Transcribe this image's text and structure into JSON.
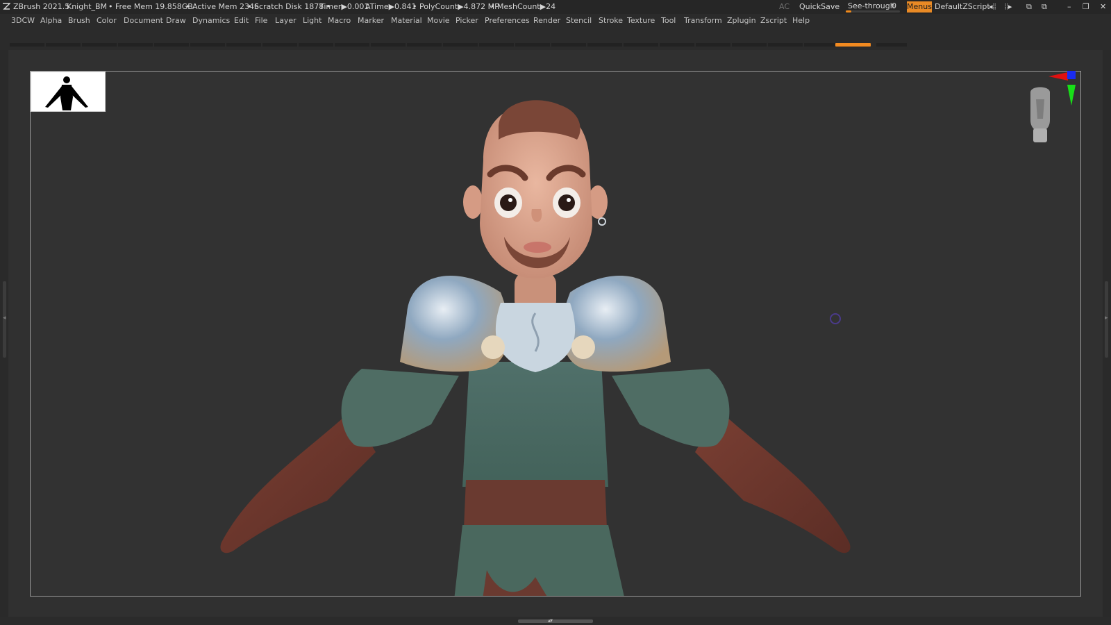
{
  "app": {
    "name": "ZBrush 2021.5",
    "document_name": "Knight_BM"
  },
  "status": {
    "free_mem": "• Free Mem 19.858GB",
    "active_mem": "• Active Mem 2346",
    "scratch_disk": "• Scratch Disk 1878 •",
    "timer": "Timer▶0.001",
    "atime": "ATime▶0.841",
    "polycount": "• PolyCount▶4.872 MP",
    "meshcount": "• MeshCount▶24"
  },
  "toolbar": {
    "ac_label": "AC",
    "quicksave_label": "QuickSave",
    "seethrough_label": "See-through",
    "seethrough_value": "0",
    "seethrough_fraction": 0.0,
    "menus_label": "Menus",
    "script_label": "DefaultZScript"
  },
  "menu": {
    "items": [
      "3DCW",
      "Alpha",
      "Brush",
      "Color",
      "Document",
      "Draw",
      "Dynamics",
      "Edit",
      "File",
      "Layer",
      "Light",
      "Macro",
      "Marker",
      "Material",
      "Movie",
      "Picker",
      "Preferences",
      "Render",
      "Stencil",
      "Stroke",
      "Texture",
      "Tool",
      "Transform",
      "Zplugin",
      "Zscript",
      "Help"
    ]
  },
  "colors": {
    "accent": "#e98a25",
    "background": "#303030",
    "skin": "#d7a38e",
    "tunic": "#4e6b60",
    "leather": "#6a3a30",
    "armor": "#9fb2c4"
  },
  "icons": {
    "app_logo": "zbrush-logo-icon",
    "left_arrows": "double-arrow-left-icon",
    "right_arrows": "double-arrow-right-icon",
    "window_mode": "window-toggle-icon",
    "window_mode2": "window-layout-icon",
    "minimize": "minimize-icon",
    "restore": "restore-icon",
    "close": "close-icon"
  }
}
